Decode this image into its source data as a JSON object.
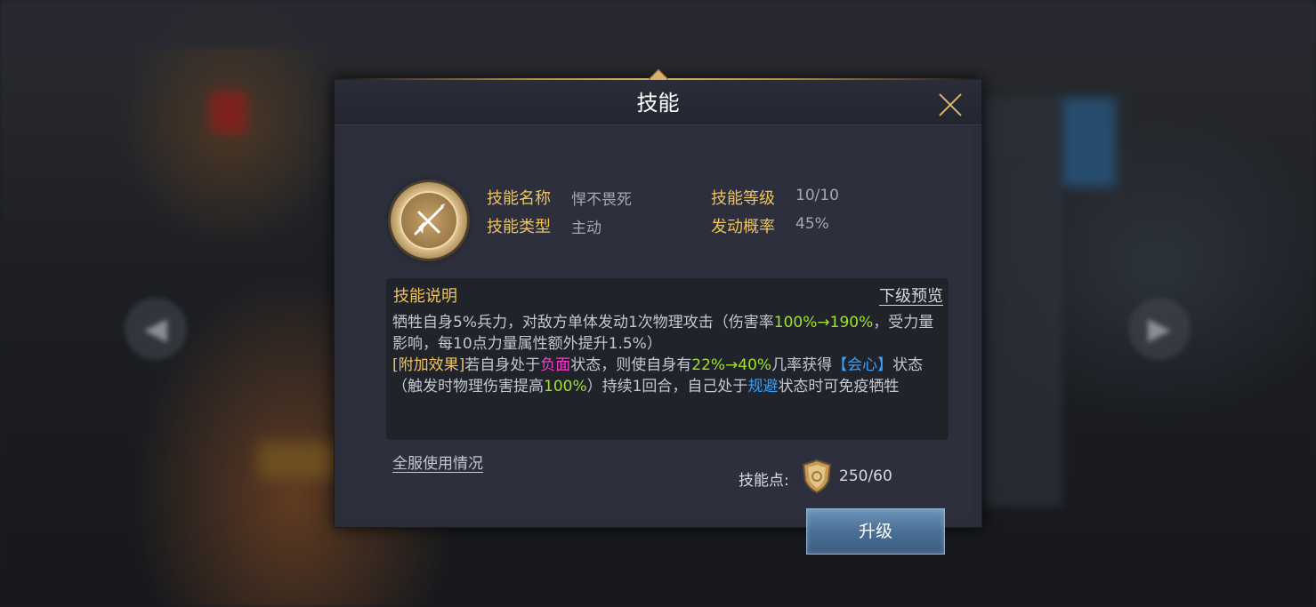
{
  "dialog": {
    "title": "技能",
    "skill": {
      "name_label": "技能名称",
      "name_value": "悍不畏死",
      "level_label": "技能等级",
      "level_value": "10/10",
      "type_label": "技能类型",
      "type_value": "主动",
      "chance_label": "发动概率",
      "chance_value": "45%"
    },
    "description": {
      "title": "技能说明",
      "preview_link": "下级预览",
      "line1_a": "牺牲自身5%兵力，对敌方单体发动1次物理攻击（伤害率",
      "line1_b": "100%→190%",
      "line1_c": "，受力量影响，每10点力量属性额外提升1.5%）",
      "extra_tag": "[附加效果]",
      "line2_a": "若自身处于",
      "line2_b": "负面",
      "line2_c": "状态，则使自身有",
      "line2_d": "22%→40%",
      "line2_e": "几率获得",
      "line2_f": "【会心】",
      "line2_g": "状态（触发时物理伤害提高",
      "line2_h": "100%",
      "line2_i": "）持续1回合，自己处于",
      "line2_j": "规避",
      "line2_k": "状态时可免疫牺牲"
    },
    "usage_link": "全服使用情况",
    "points_label": "技能点:",
    "points_value": "250/60",
    "upgrade_button": "升级"
  },
  "background": {
    "left_arrow": "◀",
    "right_arrow": "▶"
  },
  "colors": {
    "accent_gold": "#f1c25a",
    "highlight_green": "#9fe12e",
    "highlight_pink": "#ff38d2",
    "highlight_blue": "#3aa0ff"
  }
}
